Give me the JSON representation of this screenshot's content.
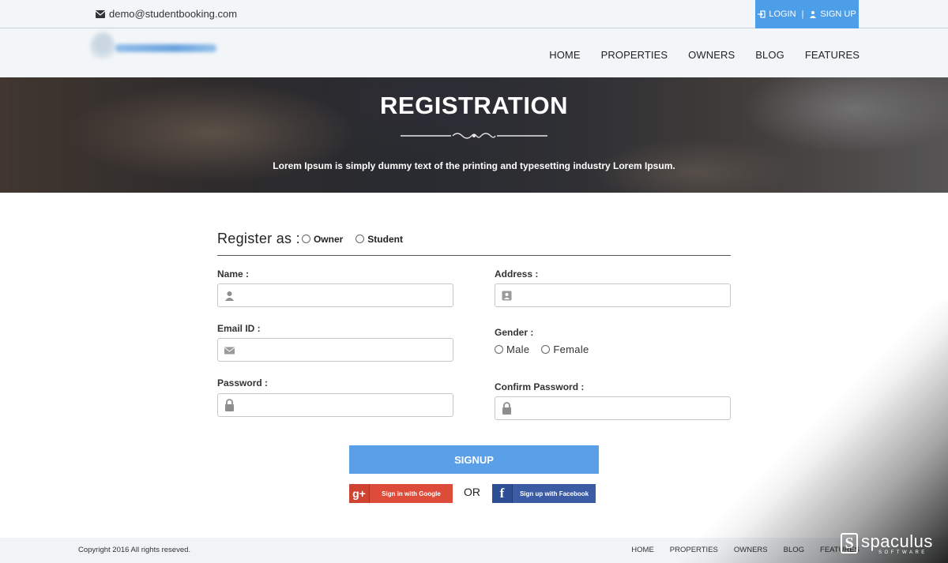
{
  "topbar": {
    "email": "demo@studentbooking.com",
    "login_label": "LOGIN",
    "separator": "|",
    "signup_label": "SIGN UP",
    "accent_color": "#4d9ee8"
  },
  "nav": {
    "items": [
      "HOME",
      "PROPERTIES",
      "OWNERS",
      "BLOG",
      "FEATURES"
    ]
  },
  "hero": {
    "title": "REGISTRATION",
    "subtitle": "Lorem Ipsum is simply dummy text of the printing and typesetting industry Lorem Ipsum."
  },
  "form": {
    "register_as_label": "Register as :",
    "role_options": [
      "Owner",
      "Student"
    ],
    "name_label": "Name :",
    "email_label": "Email ID :",
    "password_label": "Password :",
    "address_label": "Address :",
    "gender_label": "Gender :",
    "gender_options": [
      "Male",
      "Female"
    ],
    "confirm_password_label": "Confirm Password :",
    "name_value": "",
    "email_value": "",
    "password_value": "",
    "address_value": "",
    "confirm_password_value": "",
    "icons": {
      "name": "user-icon",
      "email": "envelope-icon",
      "password": "lock-icon",
      "address": "contact-card-icon",
      "confirm_password": "lock-icon"
    }
  },
  "actions": {
    "signup_label": "SIGNUP",
    "signup_color": "#5aa0e9",
    "or_label": "OR",
    "google_label": "Sign in with Google",
    "google_icon_text": "g+",
    "google_color": "#dd4b39",
    "facebook_label": "Sign up with Facebook",
    "facebook_icon_text": "f",
    "facebook_color": "#3b5ba5"
  },
  "footer": {
    "copyright": "Copyright 2016 All rights reseved.",
    "links": [
      "HOME",
      "PROPERTIES",
      "OWNERS",
      "BLOG",
      "FEATURES"
    ]
  },
  "watermark": {
    "brand": "spaculus",
    "tagline": "SOFTWARE",
    "mark": "S"
  }
}
